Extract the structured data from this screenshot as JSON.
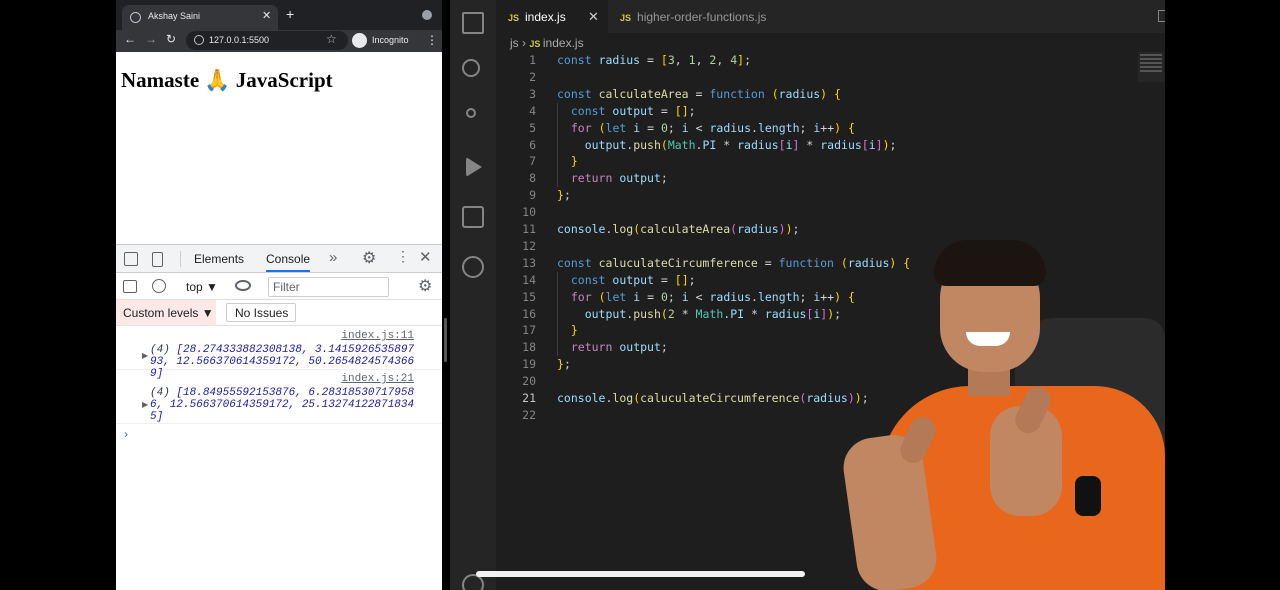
{
  "browser": {
    "tab_title": "Akshay Saini",
    "url": "127.0.0.1:5500",
    "mode": "Incognito",
    "page_heading": "Namaste 🙏 JavaScript"
  },
  "devtools": {
    "tabs": [
      "Elements",
      "Console"
    ],
    "active_tab": "Console",
    "context": "top ▼",
    "filter_placeholder": "Filter",
    "levels": "Custom levels ▼",
    "issues": "No Issues",
    "messages": [
      {
        "source": "index.js:11",
        "count": "(4)",
        "text": " [28.274333882308138, 3.141592653589793, 12.566370614359172, 50.26548245743669]"
      },
      {
        "source": "index.js:21",
        "count": "(4)",
        "text": " [18.84955592153876, 6.283185307179586, 12.566370614359172, 25.132741228718345]"
      }
    ]
  },
  "editor": {
    "tabs": [
      {
        "label": "index.js",
        "active": true
      },
      {
        "label": "higher-order-functions.js",
        "active": false
      }
    ],
    "breadcrumb": [
      "js",
      "index.js"
    ],
    "current_line": 21,
    "lines": [
      "const radius = [3, 1, 2, 4];",
      "",
      "const calculateArea = function (radius) {",
      "  const output = [];",
      "  for (let i = 0; i < radius.length; i++) {",
      "    output.push(Math.PI * radius[i] * radius[i]);",
      "  }",
      "  return output;",
      "};",
      "",
      "console.log(calculateArea(radius));",
      "",
      "const caluculateCircumference = function (radius) {",
      "  const output = [];",
      "  for (let i = 0; i < radius.length; i++) {",
      "    output.push(2 * Math.PI * radius[i]);",
      "  }",
      "  return output;",
      "};",
      "",
      "console.log(caluculateCircumference(radius));",
      ""
    ]
  }
}
